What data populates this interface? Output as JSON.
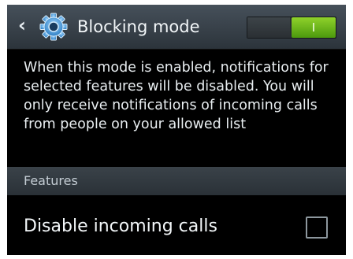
{
  "header": {
    "back_icon": "chevron-left-icon",
    "settings_icon": "gear-icon",
    "title": "Blocking mode",
    "toggle": {
      "state": "on",
      "on_label": "I"
    }
  },
  "description": "When this mode is enabled, notifications for selected features will be disabled. You will only receive notifications of incoming calls from people on your allowed list",
  "section": {
    "label": "Features"
  },
  "features": [
    {
      "label": "Disable incoming calls",
      "checked": false
    }
  ],
  "colors": {
    "toggle_on": "#6fb81f",
    "header": "#3b444c",
    "background": "#000000"
  }
}
